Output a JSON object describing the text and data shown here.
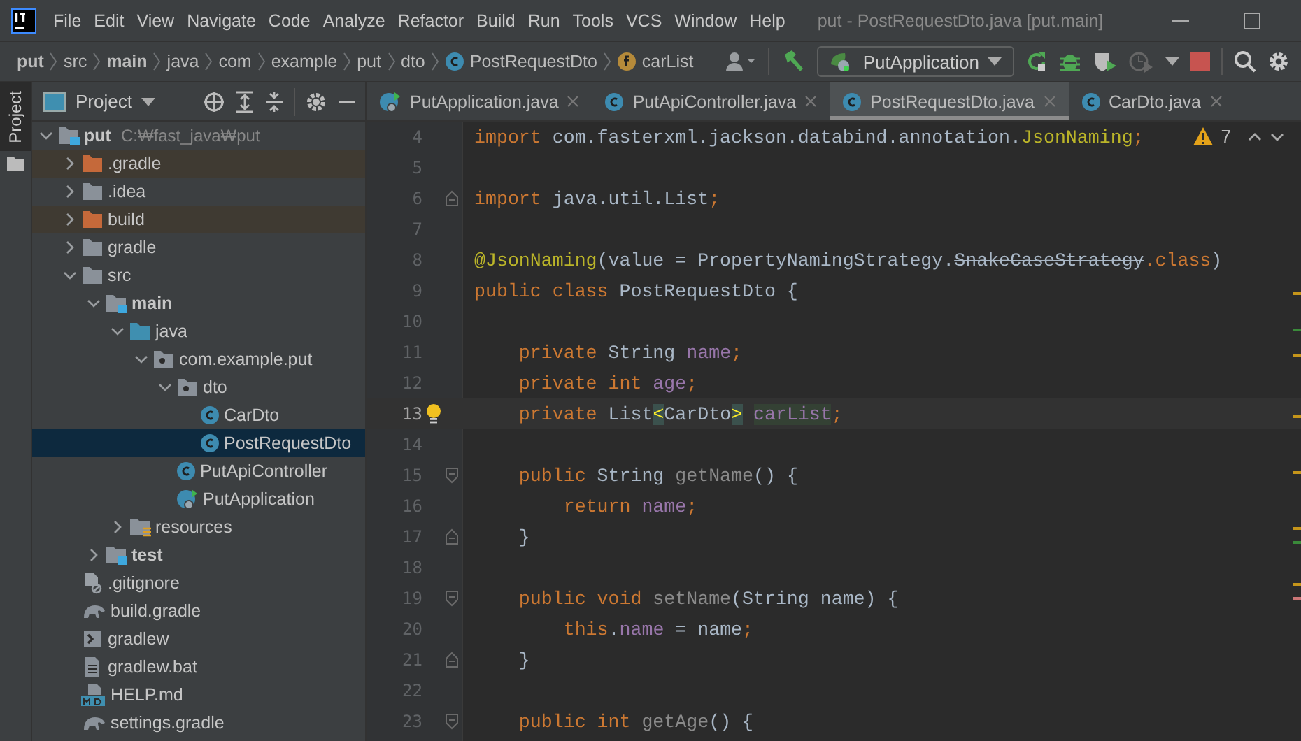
{
  "window": {
    "title": "put - PostRequestDto.java [put.main]"
  },
  "menu": [
    "File",
    "Edit",
    "View",
    "Navigate",
    "Code",
    "Analyze",
    "Refactor",
    "Build",
    "Run",
    "Tools",
    "VCS",
    "Window",
    "Help"
  ],
  "breadcrumbs": [
    {
      "label": "put",
      "bold": true,
      "kind": "plain"
    },
    {
      "label": "src",
      "bold": false,
      "kind": "plain"
    },
    {
      "label": "main",
      "bold": true,
      "kind": "plain"
    },
    {
      "label": "java",
      "bold": false,
      "kind": "plain"
    },
    {
      "label": "com",
      "bold": false,
      "kind": "plain"
    },
    {
      "label": "example",
      "bold": false,
      "kind": "plain"
    },
    {
      "label": "put",
      "bold": false,
      "kind": "plain"
    },
    {
      "label": "dto",
      "bold": false,
      "kind": "plain"
    },
    {
      "label": "PostRequestDto",
      "bold": false,
      "kind": "class"
    },
    {
      "label": "carList",
      "bold": false,
      "kind": "field"
    }
  ],
  "run_config": {
    "label": "PutApplication"
  },
  "tool_window": {
    "label": "Project"
  },
  "project_panel": {
    "title": "Project"
  },
  "tree": [
    {
      "label": "put",
      "path": "C:₩fast_java₩put",
      "kind": "module",
      "bold": true,
      "excluded": false,
      "selected": false,
      "expanded": true,
      "children": [
        {
          "label": ".gradle",
          "kind": "folder",
          "bold": false,
          "excluded": true,
          "selected": false,
          "expanded": false
        },
        {
          "label": ".idea",
          "kind": "folder",
          "bold": false,
          "excluded": false,
          "selected": false,
          "expanded": false
        },
        {
          "label": "build",
          "kind": "folder",
          "bold": false,
          "excluded": true,
          "selected": false,
          "expanded": false
        },
        {
          "label": "gradle",
          "kind": "folder",
          "bold": false,
          "excluded": false,
          "selected": false,
          "expanded": false
        },
        {
          "label": "src",
          "kind": "folder",
          "bold": false,
          "excluded": false,
          "selected": false,
          "expanded": true,
          "children": [
            {
              "label": "main",
              "kind": "module",
              "bold": true,
              "excluded": false,
              "selected": false,
              "expanded": true,
              "children": [
                {
                  "label": "java",
                  "kind": "source",
                  "bold": false,
                  "excluded": false,
                  "selected": false,
                  "expanded": true,
                  "children": [
                    {
                      "label": "com.example.put",
                      "kind": "package",
                      "bold": false,
                      "excluded": false,
                      "selected": false,
                      "expanded": true,
                      "children": [
                        {
                          "label": "dto",
                          "kind": "package",
                          "bold": false,
                          "excluded": false,
                          "selected": false,
                          "expanded": true,
                          "children": [
                            {
                              "label": "CarDto",
                              "kind": "class",
                              "bold": false,
                              "excluded": false,
                              "selected": false
                            },
                            {
                              "label": "PostRequestDto",
                              "kind": "class",
                              "bold": false,
                              "excluded": false,
                              "selected": true
                            }
                          ]
                        },
                        {
                          "label": "PutApiController",
                          "kind": "class",
                          "bold": false,
                          "excluded": false,
                          "selected": false
                        },
                        {
                          "label": "PutApplication",
                          "kind": "app",
                          "bold": false,
                          "excluded": false,
                          "selected": false
                        }
                      ]
                    }
                  ]
                },
                {
                  "label": "resources",
                  "kind": "resources",
                  "bold": false,
                  "excluded": false,
                  "selected": false,
                  "expanded": false
                }
              ]
            },
            {
              "label": "test",
              "kind": "module",
              "bold": true,
              "excluded": false,
              "selected": false,
              "expanded": false
            }
          ]
        },
        {
          "label": ".gitignore",
          "kind": "ignore",
          "bold": false,
          "excluded": false,
          "selected": false
        },
        {
          "label": "build.gradle",
          "kind": "gradle",
          "bold": false,
          "excluded": false,
          "selected": false
        },
        {
          "label": "gradlew",
          "kind": "script",
          "bold": false,
          "excluded": false,
          "selected": false
        },
        {
          "label": "gradlew.bat",
          "kind": "text",
          "bold": false,
          "excluded": false,
          "selected": false
        },
        {
          "label": "HELP.md",
          "kind": "markdown",
          "bold": false,
          "excluded": false,
          "selected": false
        },
        {
          "label": "settings.gradle",
          "kind": "gradle",
          "bold": false,
          "excluded": false,
          "selected": false
        }
      ]
    }
  ],
  "tabs": [
    {
      "label": "PutApplication.java",
      "kind": "app",
      "selected": false
    },
    {
      "label": "PutApiController.java",
      "kind": "class",
      "selected": false
    },
    {
      "label": "PostRequestDto.java",
      "kind": "class",
      "selected": true
    },
    {
      "label": "CarDto.java",
      "kind": "class",
      "selected": false
    }
  ],
  "inspections": {
    "warnings": "7"
  },
  "lines": [
    {
      "number": "4",
      "current": false,
      "bulb": false,
      "fold_start": false,
      "fold_end": false,
      "tokens": [
        {
          "kind": "kw",
          "text": "import "
        },
        {
          "kind": "plain",
          "text": "com.fasterxml.jackson.databind.annotation."
        },
        {
          "kind": "ann",
          "text": "JsonNaming"
        },
        {
          "kind": "kw",
          "text": ";"
        }
      ]
    },
    {
      "number": "5",
      "current": false,
      "bulb": false,
      "fold_start": false,
      "fold_end": false
    },
    {
      "number": "6",
      "current": false,
      "bulb": false,
      "fold_start": false,
      "fold_end": true,
      "tokens": [
        {
          "kind": "kw",
          "text": "import "
        },
        {
          "kind": "plain",
          "text": "java.util.List"
        },
        {
          "kind": "kw",
          "text": ";"
        }
      ]
    },
    {
      "number": "7",
      "current": false,
      "bulb": false,
      "fold_start": false,
      "fold_end": false
    },
    {
      "number": "8",
      "current": false,
      "bulb": false,
      "fold_start": false,
      "fold_end": false,
      "tokens": [
        {
          "kind": "ann",
          "text": "@JsonNaming"
        },
        {
          "kind": "plain",
          "text": "(value = PropertyNamingStrategy."
        },
        {
          "kind": "strike",
          "text": "SnakeCaseStrategy"
        },
        {
          "kind": "kw",
          "text": ".class"
        },
        {
          "kind": "plain",
          "text": ")"
        }
      ]
    },
    {
      "number": "9",
      "current": false,
      "bulb": false,
      "fold_start": false,
      "fold_end": false,
      "tokens": [
        {
          "kind": "kw",
          "text": "public class "
        },
        {
          "kind": "plain",
          "text": "PostRequestDto {"
        }
      ]
    },
    {
      "number": "10",
      "current": false,
      "bulb": false,
      "fold_start": false,
      "fold_end": false
    },
    {
      "number": "11",
      "current": false,
      "bulb": false,
      "fold_start": false,
      "fold_end": false,
      "tokens": [
        {
          "kind": "kw",
          "text": "    private "
        },
        {
          "kind": "plain",
          "text": "String "
        },
        {
          "kind": "field",
          "text": "name"
        },
        {
          "kind": "kw",
          "text": ";"
        }
      ]
    },
    {
      "number": "12",
      "current": false,
      "bulb": false,
      "fold_start": false,
      "fold_end": false,
      "tokens": [
        {
          "kind": "kw",
          "text": "    private int "
        },
        {
          "kind": "field",
          "text": "age"
        },
        {
          "kind": "kw",
          "text": ";"
        }
      ]
    },
    {
      "number": "13",
      "current": true,
      "bulb": true,
      "fold_start": false,
      "fold_end": false,
      "tokens": [
        {
          "kind": "kw",
          "text": "    private "
        },
        {
          "kind": "plain",
          "text": "List"
        },
        {
          "kind": "match",
          "text": "<"
        },
        {
          "kind": "plain",
          "text": "CarDto"
        },
        {
          "kind": "match",
          "text": ">"
        },
        {
          "kind": "usage",
          "text": "carList"
        },
        {
          "kind": "kw",
          "text": ";"
        }
      ]
    },
    {
      "number": "14",
      "current": false,
      "bulb": false,
      "fold_start": false,
      "fold_end": false
    },
    {
      "number": "15",
      "current": false,
      "bulb": false,
      "fold_start": true,
      "fold_end": false,
      "tokens": [
        {
          "kind": "kw",
          "text": "    public "
        },
        {
          "kind": "plain",
          "text": "String "
        },
        {
          "kind": "unused",
          "text": "getName"
        },
        {
          "kind": "plain",
          "text": "() {"
        }
      ]
    },
    {
      "number": "16",
      "current": false,
      "bulb": false,
      "fold_start": false,
      "fold_end": false,
      "tokens": [
        {
          "kind": "kw",
          "text": "        return "
        },
        {
          "kind": "field",
          "text": "name"
        },
        {
          "kind": "kw",
          "text": ";"
        }
      ]
    },
    {
      "number": "17",
      "current": false,
      "bulb": false,
      "fold_start": false,
      "fold_end": true,
      "tokens": [
        {
          "kind": "plain",
          "text": "    }"
        }
      ]
    },
    {
      "number": "18",
      "current": false,
      "bulb": false,
      "fold_start": false,
      "fold_end": false
    },
    {
      "number": "19",
      "current": false,
      "bulb": false,
      "fold_start": true,
      "fold_end": false,
      "tokens": [
        {
          "kind": "kw",
          "text": "    public void "
        },
        {
          "kind": "unused",
          "text": "setName"
        },
        {
          "kind": "plain",
          "text": "(String name) {"
        }
      ]
    },
    {
      "number": "20",
      "current": false,
      "bulb": false,
      "fold_start": false,
      "fold_end": false,
      "tokens": [
        {
          "kind": "kw",
          "text": "        this"
        },
        {
          "kind": "plain",
          "text": "."
        },
        {
          "kind": "field",
          "text": "name"
        },
        {
          "kind": "plain",
          "text": " = name"
        },
        {
          "kind": "kw",
          "text": ";"
        }
      ]
    },
    {
      "number": "21",
      "current": false,
      "bulb": false,
      "fold_start": false,
      "fold_end": true,
      "tokens": [
        {
          "kind": "plain",
          "text": "    }"
        }
      ]
    },
    {
      "number": "22",
      "current": false,
      "bulb": false,
      "fold_start": false,
      "fold_end": false
    },
    {
      "number": "23",
      "current": false,
      "bulb": false,
      "fold_start": true,
      "fold_end": false,
      "tokens": [
        {
          "kind": "kw",
          "text": "    public int "
        },
        {
          "kind": "unused",
          "text": "getAge"
        },
        {
          "kind": "plain",
          "text": "() {"
        }
      ]
    }
  ]
}
